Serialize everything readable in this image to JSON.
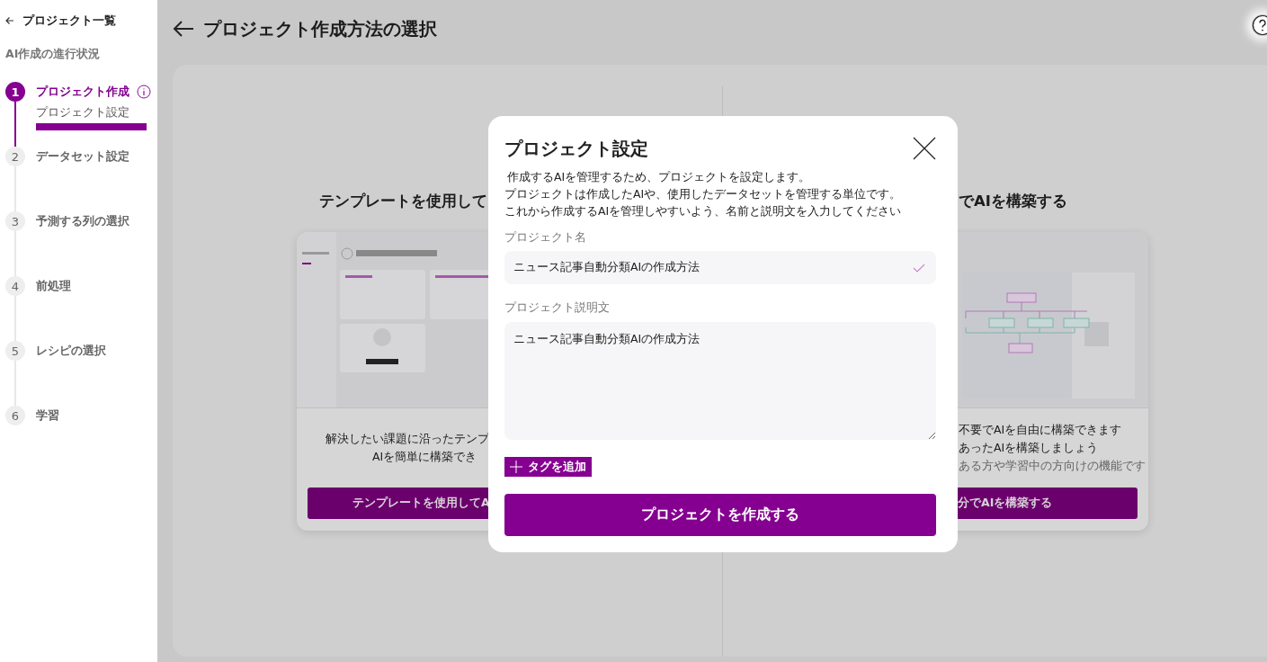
{
  "sidebar": {
    "back_link": "プロジェクト一覧",
    "progress_title": "AI作成の進行状況",
    "steps": [
      {
        "number": "1",
        "label": "プロジェクト作成",
        "selected": true,
        "info": true,
        "children": [
          {
            "label": "プロジェクト設定",
            "selected": true
          }
        ]
      },
      {
        "number": "2",
        "label": "データセット設定",
        "selected": false,
        "info": false
      },
      {
        "number": "3",
        "label": "予測する列の選択",
        "selected": false,
        "info": false
      },
      {
        "number": "4",
        "label": "前処理",
        "selected": false,
        "info": false
      },
      {
        "number": "5",
        "label": "レシピの選択",
        "selected": false,
        "info": false
      },
      {
        "number": "6",
        "label": "学習",
        "selected": false,
        "info": false
      }
    ]
  },
  "header": {
    "title": "プロジェクト作成方法の選択"
  },
  "options": [
    {
      "kind": "template",
      "title": "テンプレートを使用して",
      "lines": [
        {
          "text": "解決したい課題に沿ったテンプ",
          "muted": false
        },
        {
          "text": "AIを簡単に構築でき",
          "muted": false
        }
      ],
      "button": "テンプレートを使用してA"
    },
    {
      "kind": "custom",
      "title": "でAIを構築する",
      "lines": [
        {
          "text": "不要でAIを自由に構築できます",
          "muted": false
        },
        {
          "text": "あったAIを構築しましょう",
          "muted": false
        },
        {
          "text": "ある方や学習中の方向けの機能です",
          "muted": true
        }
      ],
      "button": "分でAIを構築する"
    }
  ],
  "dialog": {
    "title": "プロジェクト設定",
    "description": [
      "作成するAIを管理するため、プロジェクトを設定します。",
      "プロジェクトは作成したAIや、使用したデータセットを管理する単位です。",
      "これから作成するAIを管理しやすいよう、名前と説明文を入力してください"
    ],
    "name_field": {
      "label": "プロジェクト名",
      "value": "ニュース記事自動分類AIの作成方法",
      "valid": true
    },
    "description_field": {
      "label": "プロジェクト説明文",
      "value": "ニュース記事自動分類AIの作成方法"
    },
    "tag_button": "タグを追加",
    "submit_button": "プロジェクトを作成する"
  }
}
